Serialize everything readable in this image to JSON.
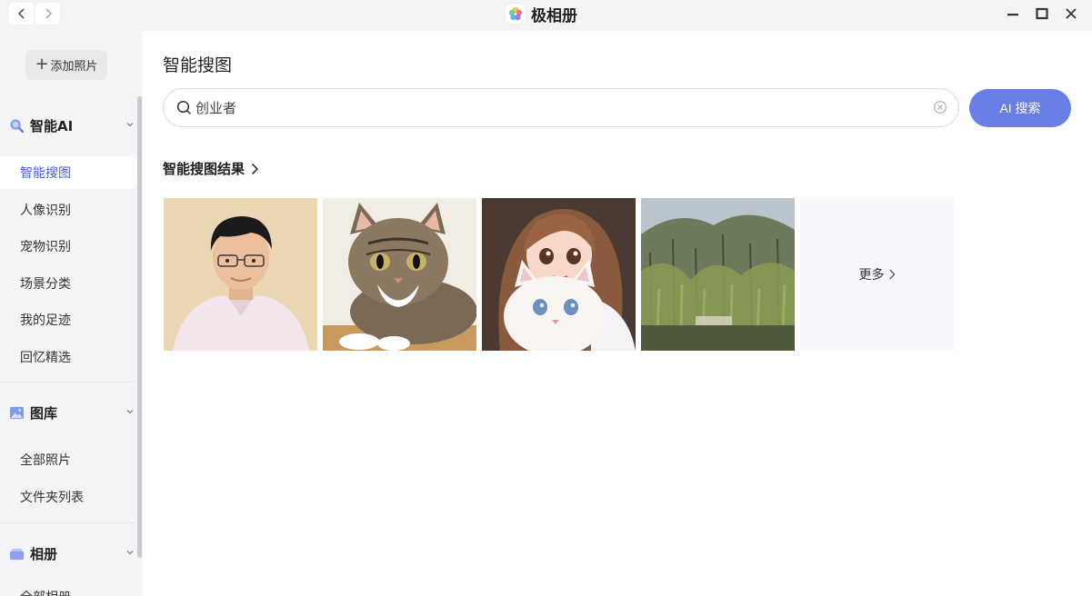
{
  "window": {
    "title": "极相册",
    "nav_back": "back-icon",
    "nav_forward": "forward-icon",
    "controls": [
      "minimize-icon",
      "maximize-icon",
      "close-icon"
    ]
  },
  "sidebar": {
    "add_button": {
      "icon": "plus-icon",
      "label": "添加照片"
    },
    "sections": [
      {
        "icon": "ai-search-icon",
        "label": "智能AI",
        "expanded": true,
        "items": [
          {
            "label": "智能搜图",
            "active": true
          },
          {
            "label": "人像识别",
            "active": false
          },
          {
            "label": "宠物识别",
            "active": false
          },
          {
            "label": "场景分类",
            "active": false
          },
          {
            "label": "我的足迹",
            "active": false
          },
          {
            "label": "回忆精选",
            "active": false
          }
        ]
      },
      {
        "icon": "gallery-icon",
        "label": "图库",
        "expanded": true,
        "items": [
          {
            "label": "全部照片",
            "active": false
          },
          {
            "label": "文件夹列表",
            "active": false
          }
        ]
      },
      {
        "icon": "album-icon",
        "label": "相册",
        "expanded": true,
        "items": [
          {
            "label": "全部相册",
            "active": false
          }
        ]
      }
    ]
  },
  "main": {
    "title": "智能搜图",
    "search": {
      "value": "创业者",
      "placeholder": ""
    },
    "ai_button": "AI 搜索",
    "results_title": "智能搜图结果",
    "thumbnails": [
      {
        "subject": "portrait-photo"
      },
      {
        "subject": "tabby-cat-photo"
      },
      {
        "subject": "girl-with-white-cat-illustration"
      },
      {
        "subject": "willow-trees-photo"
      }
    ],
    "more_label": "更多"
  },
  "colors": {
    "accent": "#4a5ee0",
    "ai_button": "#6a7ee8",
    "sidebar_bg": "#f4f4f6"
  }
}
